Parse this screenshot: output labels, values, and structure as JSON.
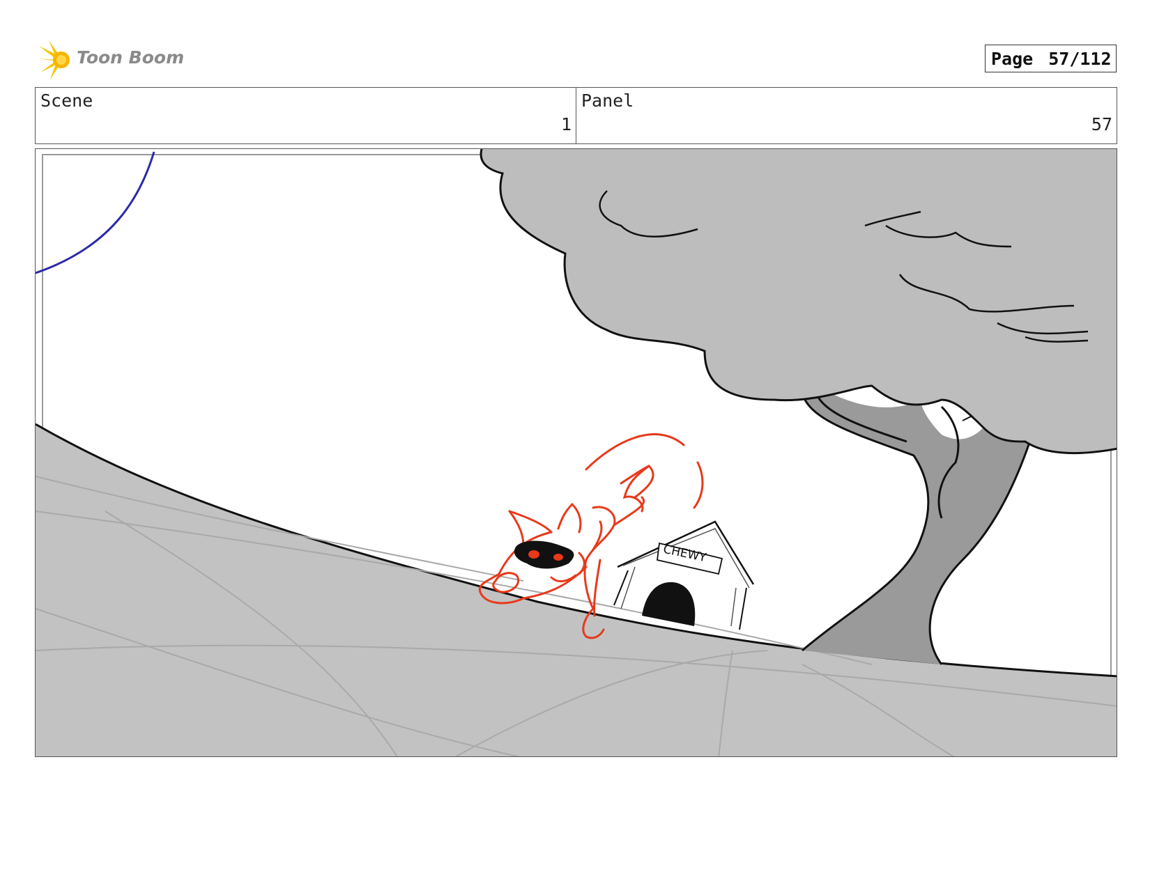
{
  "header": {
    "logo_text": "Toon Boom",
    "page_label": "Page",
    "page_value": "57/112"
  },
  "info": {
    "scene_label": "Scene",
    "scene_value": "1",
    "panel_label": "Panel",
    "panel_value": "57"
  },
  "drawing": {
    "doghouse_sign": "CHEWY",
    "colors": {
      "ground": "#c2c2c2",
      "tree_canopy": "#bdbdbd",
      "tree_trunk": "#9a9a9a",
      "dog_outline": "#e8391a",
      "sky_arc": "#2a2aa8"
    }
  }
}
